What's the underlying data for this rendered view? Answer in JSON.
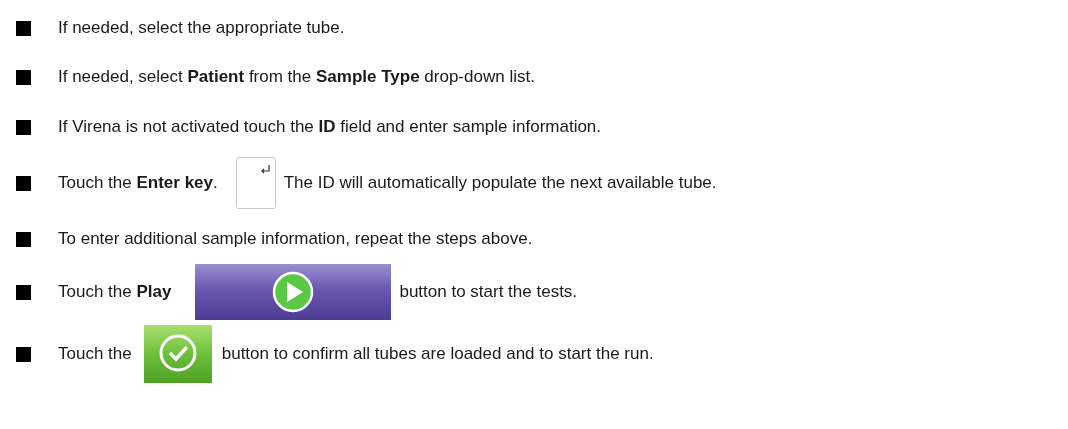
{
  "steps": [
    {
      "before": "If needed, select the appropriate tube."
    },
    {
      "before": "If needed, select **Patient** from the **Sample Type** drop-down list."
    },
    {
      "before": "If Virena is not activated touch the **ID** field and enter sample information."
    },
    {
      "before": "Touch the **Enter key**.",
      "button": {
        "kind": "enter-key"
      },
      "after": "The ID will automatically populate the next available tube."
    },
    {
      "before": "To enter additional sample information, repeat the steps above."
    },
    {
      "before": "Touch the **Play**",
      "button": {
        "kind": "play"
      },
      "after": "button to start the tests."
    },
    {
      "before": "Touch the",
      "button": {
        "kind": "confirm"
      },
      "after": "button to confirm all tubes are loaded and to start the run."
    }
  ]
}
